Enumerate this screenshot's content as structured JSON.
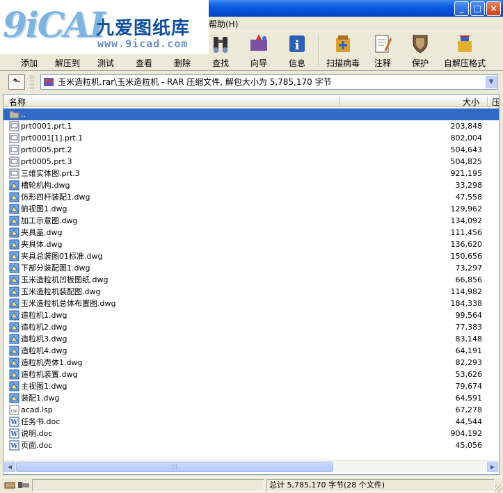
{
  "logo": {
    "mark": "9iCAI",
    "name_cn": "九爱图纸库",
    "url": "www.9icad.com"
  },
  "window": {
    "minimize": "_",
    "maximize": "□",
    "close": "×"
  },
  "menu": {
    "help": "帮助(H)"
  },
  "toolbar": {
    "add": "添加",
    "extract_to": "解压到",
    "test": "测试",
    "view": "查看",
    "delete": "删除",
    "find": "查找",
    "wizard": "向导",
    "info": "信息",
    "virus_scan": "扫描病毒",
    "comment": "注释",
    "protect": "保护",
    "sfx": "自解压格式"
  },
  "address": {
    "text": "玉米造粒机.rar\\玉米造粒机 - RAR 压缩文件, 解包大小为 5,785,170 字节"
  },
  "list": {
    "col_name": "名称",
    "col_size": "大小",
    "col_extra": "压",
    "parent": "..",
    "files": [
      {
        "name": "prt0001.prt.1",
        "size": "203,848",
        "type": "prt"
      },
      {
        "name": "prt0001[1].prt.1",
        "size": "802,004",
        "type": "prt"
      },
      {
        "name": "prt0005.prt.2",
        "size": "504,643",
        "type": "prt"
      },
      {
        "name": "prt0005.prt.3",
        "size": "504,825",
        "type": "prt"
      },
      {
        "name": "三维实体图.prt.3",
        "size": "921,195",
        "type": "prt"
      },
      {
        "name": "槽轮机构.dwg",
        "size": "33,298",
        "type": "dwg"
      },
      {
        "name": "仿形四杆装配1.dwg",
        "size": "47,558",
        "type": "dwg"
      },
      {
        "name": "俯视图1.dwg",
        "size": "129,962",
        "type": "dwg"
      },
      {
        "name": "加工示意图.dwg",
        "size": "134,092",
        "type": "dwg"
      },
      {
        "name": "夹具盖.dwg",
        "size": "111,456",
        "type": "dwg"
      },
      {
        "name": "夹具体.dwg",
        "size": "136,620",
        "type": "dwg"
      },
      {
        "name": "夹具总装图01标准.dwg",
        "size": "150,656",
        "type": "dwg"
      },
      {
        "name": "下部分装配图1.dwg",
        "size": "73,297",
        "type": "dwg"
      },
      {
        "name": "玉米造粒机凹板图纸.dwg",
        "size": "66,856",
        "type": "dwg"
      },
      {
        "name": "玉米造粒机装配图.dwg",
        "size": "114,982",
        "type": "dwg"
      },
      {
        "name": "玉米造粒机总体布置图.dwg",
        "size": "184,338",
        "type": "dwg"
      },
      {
        "name": "造粒机1.dwg",
        "size": "99,564",
        "type": "dwg"
      },
      {
        "name": "造粒机2.dwg",
        "size": "77,383",
        "type": "dwg"
      },
      {
        "name": "造粒机3.dwg",
        "size": "83,148",
        "type": "dwg"
      },
      {
        "name": "造粒机4.dwg",
        "size": "64,191",
        "type": "dwg"
      },
      {
        "name": "造粒机壳体1.dwg",
        "size": "82,293",
        "type": "dwg"
      },
      {
        "name": "造粒机装置.dwg",
        "size": "53,626",
        "type": "dwg"
      },
      {
        "name": "主视图1.dwg",
        "size": "79,674",
        "type": "dwg"
      },
      {
        "name": "装配1.dwg",
        "size": "64,591",
        "type": "dwg"
      },
      {
        "name": "acad.lsp",
        "size": "67,278",
        "type": "lsp"
      },
      {
        "name": "任务书.doc",
        "size": "44,544",
        "type": "doc"
      },
      {
        "name": "说明.doc",
        "size": "904,192",
        "type": "doc"
      },
      {
        "name": "页面.doc",
        "size": "45,056",
        "type": "doc"
      }
    ]
  },
  "scrollbar": {
    "grip": "|||"
  },
  "status": {
    "total": "总计 5,785,170 字节(28 个文件)"
  },
  "colors": {
    "selection": "#316ac5",
    "titlebar": "#0a5ae0",
    "chrome": "#ece9d8"
  }
}
